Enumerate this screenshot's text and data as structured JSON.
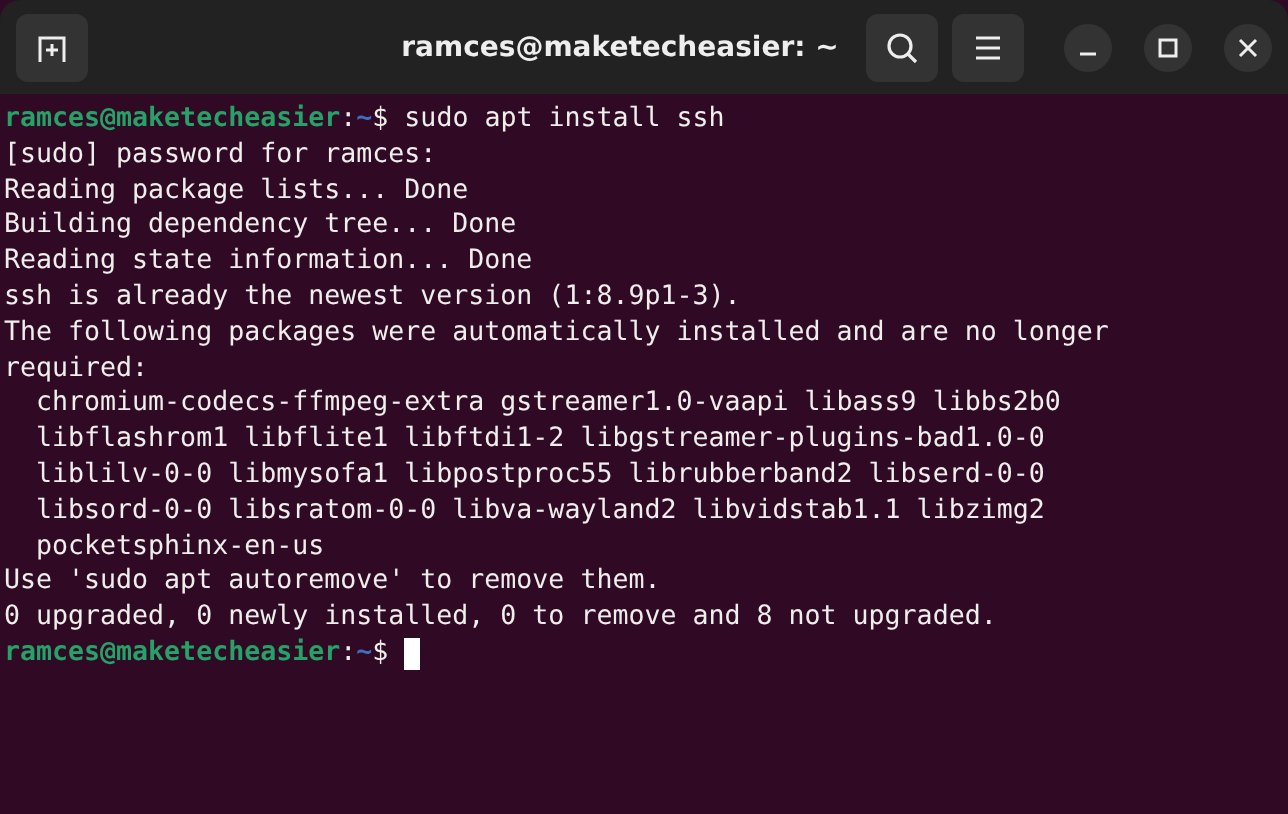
{
  "window": {
    "title": "ramces@maketecheasier: ~"
  },
  "terminal": {
    "lines": [
      {
        "kind": "prompt",
        "user": "ramces@maketecheasier",
        "separator": ":",
        "path": "~",
        "symbol": "$",
        "command": " sudo apt install ssh",
        "cursor": false
      },
      {
        "kind": "output",
        "text": "[sudo] password for ramces:"
      },
      {
        "kind": "output",
        "text": "Reading package lists... Done"
      },
      {
        "kind": "output",
        "text": "Building dependency tree... Done"
      },
      {
        "kind": "output",
        "text": "Reading state information... Done"
      },
      {
        "kind": "output",
        "text": "ssh is already the newest version (1:8.9p1-3)."
      },
      {
        "kind": "output",
        "text": "The following packages were automatically installed and are no longer"
      },
      {
        "kind": "output",
        "text": "required:"
      },
      {
        "kind": "output",
        "text": "  chromium-codecs-ffmpeg-extra gstreamer1.0-vaapi libass9 libbs2b0"
      },
      {
        "kind": "output",
        "text": "  libflashrom1 libflite1 libftdi1-2 libgstreamer-plugins-bad1.0-0"
      },
      {
        "kind": "output",
        "text": "  liblilv-0-0 libmysofa1 libpostproc55 librubberband2 libserd-0-0"
      },
      {
        "kind": "output",
        "text": "  libsord-0-0 libsratom-0-0 libva-wayland2 libvidstab1.1 libzimg2"
      },
      {
        "kind": "output",
        "text": "  pocketsphinx-en-us"
      },
      {
        "kind": "output",
        "text": "Use 'sudo apt autoremove' to remove them."
      },
      {
        "kind": "output",
        "text": "0 upgraded, 0 newly installed, 0 to remove and 8 not upgraded."
      },
      {
        "kind": "prompt",
        "user": "ramces@maketecheasier",
        "separator": ":",
        "path": "~",
        "symbol": "$",
        "cursor": true
      }
    ]
  }
}
